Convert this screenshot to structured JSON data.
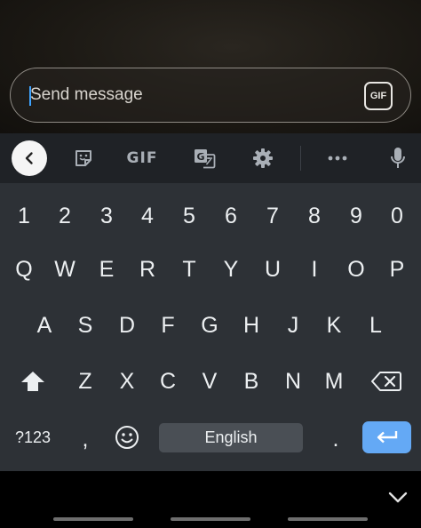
{
  "composer": {
    "placeholder": "Send message",
    "gif_label": "GIF"
  },
  "toolbar": {
    "gif_label": "GIF",
    "items": [
      "back",
      "sticker",
      "gif",
      "translate",
      "settings",
      "more",
      "voice"
    ]
  },
  "keyboard": {
    "number_row": [
      "1",
      "2",
      "3",
      "4",
      "5",
      "6",
      "7",
      "8",
      "9",
      "0"
    ],
    "row1": [
      "Q",
      "W",
      "E",
      "R",
      "T",
      "Y",
      "U",
      "I",
      "O",
      "P"
    ],
    "row2": [
      "A",
      "S",
      "D",
      "F",
      "G",
      "H",
      "J",
      "K",
      "L"
    ],
    "row3": [
      "Z",
      "X",
      "C",
      "V",
      "B",
      "N",
      "M"
    ],
    "symbols_label": "?123",
    "comma_label": ",",
    "space_label": "English",
    "period_label": "."
  },
  "colors": {
    "accent_blue": "#64a9f5",
    "keyboard_bg": "#2d3136",
    "toolbar_bg": "#1f2226"
  }
}
